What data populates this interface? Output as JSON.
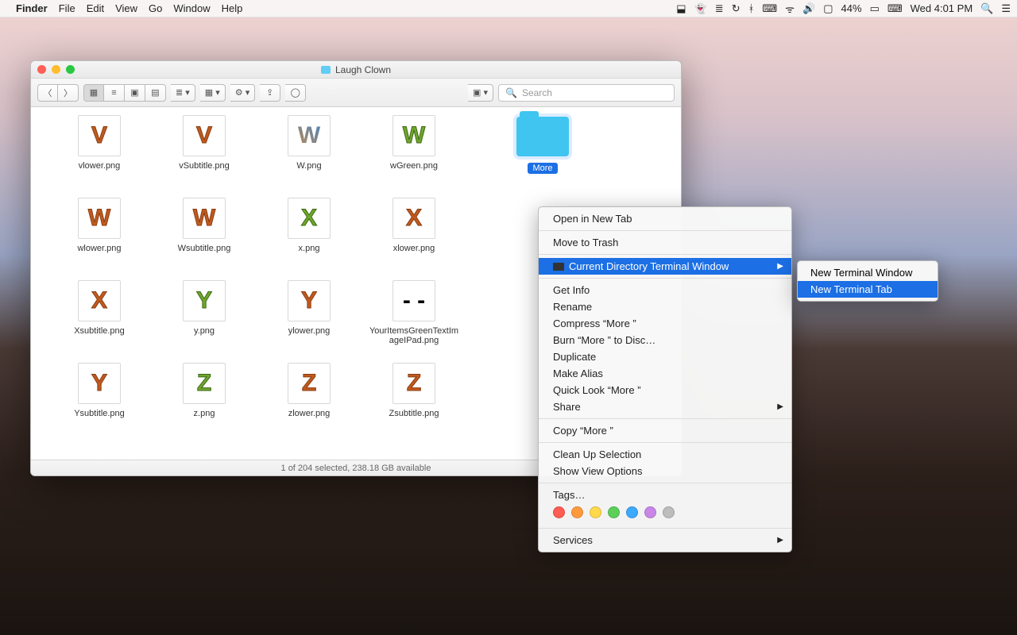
{
  "menubar": {
    "app": "Finder",
    "items": [
      "File",
      "Edit",
      "View",
      "Go",
      "Window",
      "Help"
    ],
    "right": {
      "battery_pct": "44%",
      "clock": "Wed 4:01 PM"
    }
  },
  "finder": {
    "title": "Laugh Clown",
    "search_placeholder": "Search",
    "status": "1 of 204 selected, 238.18 GB available",
    "files": [
      {
        "name": "vlower.png",
        "letter": "V",
        "cls": "letter-orange"
      },
      {
        "name": "vSubtitle.png",
        "letter": "V",
        "cls": "letter-orange"
      },
      {
        "name": "W.png",
        "letter": "W",
        "cls": "letter-mixed"
      },
      {
        "name": "wGreen.png",
        "letter": "W",
        "cls": "letter-green"
      },
      {
        "name": "wlower.png",
        "letter": "W",
        "cls": "letter-orange"
      },
      {
        "name": "Wsubtitle.png",
        "letter": "W",
        "cls": "letter-orange"
      },
      {
        "name": "x.png",
        "letter": "X",
        "cls": "letter-green"
      },
      {
        "name": "xlower.png",
        "letter": "X",
        "cls": "letter-orange"
      },
      {
        "name": "Xsubtitle.png",
        "letter": "X",
        "cls": "letter-orange"
      },
      {
        "name": "y.png",
        "letter": "Y",
        "cls": "letter-green"
      },
      {
        "name": "ylower.png",
        "letter": "Y",
        "cls": "letter-orange"
      },
      {
        "name": "YourItemsGreenTextImageIPad.png",
        "letter": "- -",
        "cls": ""
      },
      {
        "name": "Ysubtitle.png",
        "letter": "Y",
        "cls": "letter-orange"
      },
      {
        "name": "z.png",
        "letter": "Z",
        "cls": "letter-green"
      },
      {
        "name": "zlower.png",
        "letter": "Z",
        "cls": "letter-orange"
      },
      {
        "name": "Zsubtitle.png",
        "letter": "Z",
        "cls": "letter-orange"
      }
    ],
    "selected_folder": "More"
  },
  "context_menu": {
    "open_new_tab": "Open in New Tab",
    "move_to_trash": "Move to Trash",
    "current_dir_terminal": "Current Directory Terminal Window",
    "get_info": "Get Info",
    "rename": "Rename",
    "compress": "Compress “More ”",
    "burn": "Burn “More ” to Disc…",
    "duplicate": "Duplicate",
    "make_alias": "Make Alias",
    "quick_look": "Quick Look “More ”",
    "share": "Share",
    "copy": "Copy “More ”",
    "clean_up": "Clean Up Selection",
    "show_view_options": "Show View Options",
    "tags": "Tags…",
    "services": "Services",
    "tag_colors": [
      "#ff5c53",
      "#ff9a3c",
      "#ffd94b",
      "#5ccf58",
      "#3da9fc",
      "#c886e6",
      "#bdbdbd"
    ]
  },
  "submenu": {
    "new_window": "New Terminal Window",
    "new_tab": "New Terminal Tab"
  }
}
